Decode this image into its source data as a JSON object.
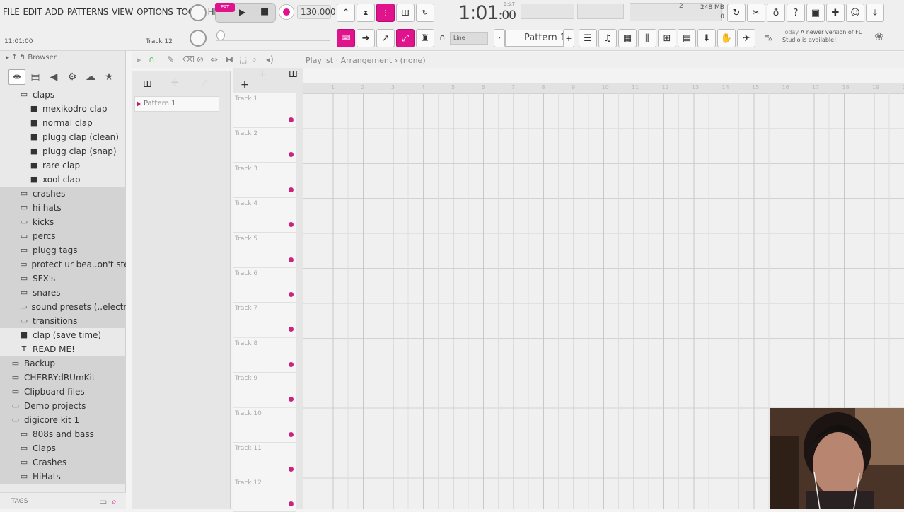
{
  "menu": [
    "FILE",
    "EDIT",
    "ADD",
    "PATTERNS",
    "VIEW",
    "OPTIONS",
    "TOOLS",
    "HELP"
  ],
  "transport": {
    "mode_label": "PAT",
    "tempo": "130.000",
    "time": "1:01",
    "time_sub": ":00",
    "bst": "B:S:T"
  },
  "status": {
    "cpu": "2",
    "memory": "248 MB",
    "voices": "0"
  },
  "hint": {
    "left": "11:01:00",
    "track": "Track 12"
  },
  "snap_label": "Line",
  "pattern_selector": "Pattern 1",
  "news": {
    "prefix": "Today",
    "text": "A newer version of FL Studio is available!"
  },
  "browser": {
    "title": "Browser",
    "tags": "TAGS",
    "items": [
      {
        "label": "claps",
        "type": "folder",
        "level": "lv1",
        "shade": false
      },
      {
        "label": "mexikodro clap",
        "type": "file",
        "level": "lv2",
        "shade": false
      },
      {
        "label": "normal clap",
        "type": "file",
        "level": "lv2",
        "shade": false
      },
      {
        "label": "plugg clap (clean)",
        "type": "file",
        "level": "lv2",
        "shade": false
      },
      {
        "label": "plugg clap (snap)",
        "type": "file",
        "level": "lv2",
        "shade": false
      },
      {
        "label": "rare clap",
        "type": "file",
        "level": "lv2",
        "shade": false
      },
      {
        "label": "xool clap",
        "type": "file",
        "level": "lv2",
        "shade": false
      },
      {
        "label": "crashes",
        "type": "folder",
        "level": "lv1",
        "shade": true
      },
      {
        "label": "hi hats",
        "type": "folder",
        "level": "lv1",
        "shade": true
      },
      {
        "label": "kicks",
        "type": "folder",
        "level": "lv1",
        "shade": true
      },
      {
        "label": "percs",
        "type": "folder",
        "level": "lv1",
        "shade": true
      },
      {
        "label": "plugg tags",
        "type": "folder",
        "level": "lv1",
        "shade": true
      },
      {
        "label": "protect ur bea..on't steal it)",
        "type": "folder",
        "level": "lv1",
        "shade": true
      },
      {
        "label": "SFX's",
        "type": "folder",
        "level": "lv1",
        "shade": true
      },
      {
        "label": "snares",
        "type": "folder",
        "level": "lv1",
        "shade": true
      },
      {
        "label": "sound presets (..electrax...)",
        "type": "folder",
        "level": "lv1",
        "shade": true
      },
      {
        "label": "transitions",
        "type": "folder",
        "level": "lv1",
        "shade": true
      },
      {
        "label": "clap (save time)",
        "type": "file",
        "level": "lv1",
        "shade": false
      },
      {
        "label": "READ ME!",
        "type": "text",
        "level": "lv1",
        "shade": false
      },
      {
        "label": "Backup",
        "type": "folder",
        "level": "lv0",
        "shade": true
      },
      {
        "label": "CHERRYdRUmKit",
        "type": "folder",
        "level": "lv0",
        "shade": true
      },
      {
        "label": "Clipboard files",
        "type": "folder",
        "level": "lv0",
        "shade": true
      },
      {
        "label": "Demo projects",
        "type": "folder",
        "level": "lv0",
        "shade": true
      },
      {
        "label": "digicore kit 1",
        "type": "folder",
        "level": "lv0",
        "shade": true
      },
      {
        "label": "808s and bass",
        "type": "folder",
        "level": "lv1",
        "shade": true
      },
      {
        "label": "Claps",
        "type": "folder",
        "level": "lv1",
        "shade": true
      },
      {
        "label": "Crashes",
        "type": "folder",
        "level": "lv1",
        "shade": true
      },
      {
        "label": "HiHats",
        "type": "folder",
        "level": "lv1",
        "shade": true
      }
    ]
  },
  "playlist": {
    "title": "Playlist · Arrangement › (none)",
    "pattern": "Pattern 1",
    "tracks": [
      "Track 1",
      "Track 2",
      "Track 3",
      "Track 4",
      "Track 5",
      "Track 6",
      "Track 7",
      "Track 8",
      "Track 9",
      "Track 10",
      "Track 11",
      "Track 12"
    ],
    "ruler": [
      "1",
      "2",
      "3",
      "4",
      "5",
      "6",
      "7",
      "8",
      "9",
      "10",
      "11",
      "12",
      "13",
      "14",
      "15",
      "16",
      "17",
      "18",
      "19",
      "20"
    ]
  },
  "colors": {
    "accent": "#e0138c",
    "track_dot": "#c9257d"
  }
}
